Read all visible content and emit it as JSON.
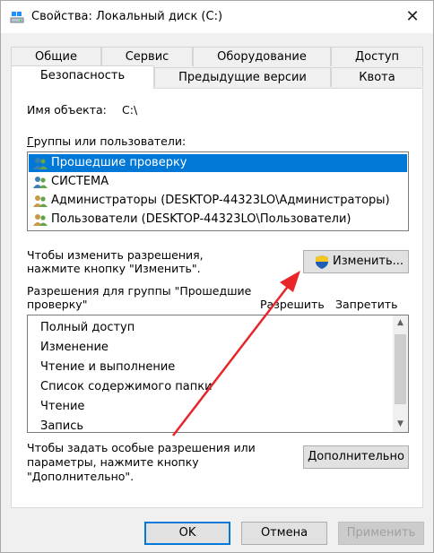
{
  "window": {
    "title": "Свойства: Локальный диск (C:)",
    "close": "✕"
  },
  "tabs": {
    "row1": [
      "Общие",
      "Сервис",
      "Оборудование",
      "Доступ"
    ],
    "row2": [
      "Безопасность",
      "Предыдущие версии",
      "Квота"
    ],
    "active": "Безопасность"
  },
  "security": {
    "object_name_label": "Имя объекта:",
    "object_name_value": "C:\\",
    "groups_label": "Группы или пользователи:",
    "groups": [
      "Прошедшие проверку",
      "СИСТЕМА",
      "Администраторы (DESKTOP-44323LO\\Администраторы)",
      "Пользователи (DESKTOP-44323LO\\Пользователи)"
    ],
    "selected_group_index": 0,
    "change_hint_line1": "Чтобы изменить разрешения,",
    "change_hint_line2": "нажмите кнопку \"Изменить\".",
    "change_button": "Изменить...",
    "perms_label_line1": "Разрешения для группы \"Прошедшие",
    "perms_label_line2": "проверку\"",
    "allow_col": "Разрешить",
    "deny_col": "Запретить",
    "permissions": [
      "Полный доступ",
      "Изменение",
      "Чтение и выполнение",
      "Список содержимого папки",
      "Чтение",
      "Запись"
    ],
    "advanced_hint_line1": "Чтобы задать особые разрешения или",
    "advanced_hint_line2": "параметры, нажмите кнопку",
    "advanced_hint_line3": "\"Дополнительно\".",
    "advanced_button": "Дополнительно"
  },
  "footer": {
    "ok": "OK",
    "cancel": "Отмена",
    "apply": "Применить"
  },
  "colors": {
    "accent": "#0078d7",
    "annotation_arrow": "#e8262a"
  }
}
